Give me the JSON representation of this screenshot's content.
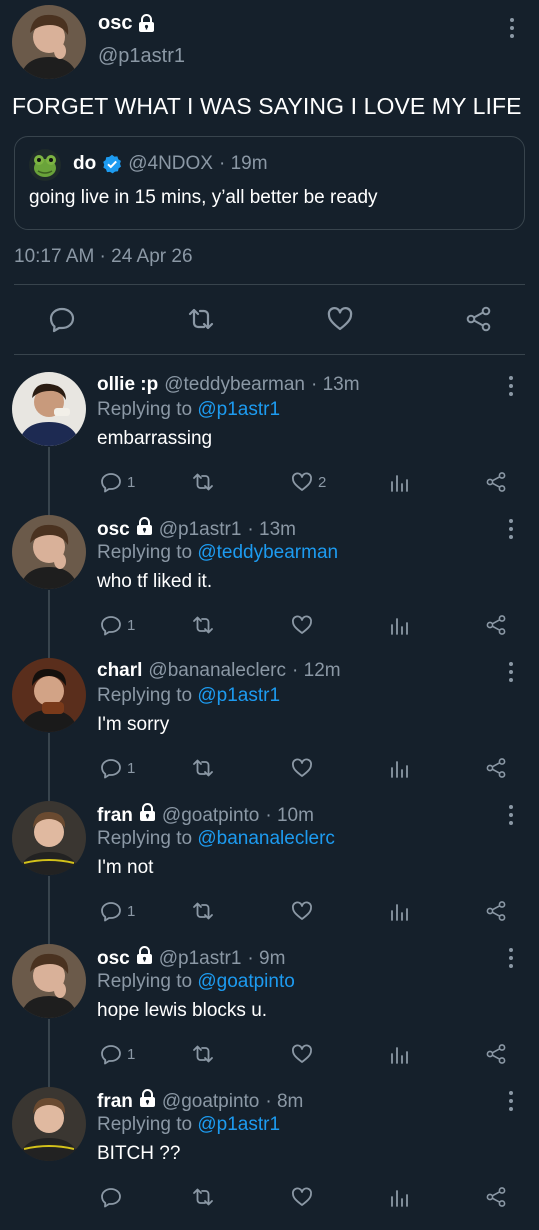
{
  "main_tweet": {
    "display_name": "osc",
    "handle": "@p1astr1",
    "text": "FORGET WHAT I WAS SAYING I LOVE MY LIFE",
    "quote": {
      "display_name": "do",
      "handle": "@4NDOX",
      "time": "· 19m",
      "text": "going live in 15 mins, y’all better be ready"
    },
    "timestamp": "10:17 AM · 24 Apr 26"
  },
  "replies": [
    {
      "name": "ollie :p",
      "handle": "@teddybearman",
      "time": "· 13m",
      "replying_label": "Replying to",
      "replying_to": "@p1astr1",
      "text": "embarrassing",
      "reply_count": "1",
      "like_count": "2",
      "locked": false
    },
    {
      "name": "osc",
      "handle": "@p1astr1",
      "time": "· 13m",
      "replying_label": "Replying to",
      "replying_to": "@teddybearman",
      "text": "who tf liked it.",
      "reply_count": "1",
      "like_count": "",
      "locked": true
    },
    {
      "name": "charl",
      "handle": "@bananaleclerc",
      "time": "· 12m",
      "replying_label": "Replying to",
      "replying_to": "@p1astr1",
      "text": "I'm sorry",
      "reply_count": "1",
      "like_count": "",
      "locked": false
    },
    {
      "name": "fran",
      "handle": "@goatpinto",
      "time": "· 10m",
      "replying_label": "Replying to",
      "replying_to": "@bananaleclerc",
      "text": "I'm not",
      "reply_count": "1",
      "like_count": "",
      "locked": true
    },
    {
      "name": "osc",
      "handle": "@p1astr1",
      "time": "· 9m",
      "replying_label": "Replying to",
      "replying_to": "@goatpinto",
      "text": "hope lewis blocks u.",
      "reply_count": "1",
      "like_count": "",
      "locked": true
    },
    {
      "name": "fran",
      "handle": "@goatpinto",
      "time": "· 8m",
      "replying_label": "Replying to",
      "replying_to": "@p1astr1",
      "text": "BITCH ??",
      "reply_count": "",
      "like_count": "",
      "locked": true
    }
  ],
  "colors": {
    "background": "#15202b",
    "text": "#ffffff",
    "secondary": "#8b98a5",
    "accent": "#1d9bf0",
    "divider": "#38444d"
  },
  "icons": {
    "reply": "reply-icon",
    "retweet": "retweet-icon",
    "like": "heart-icon",
    "views": "analytics-icon",
    "share": "share-icon",
    "lock": "lock-icon",
    "verified": "verified-badge-icon"
  }
}
